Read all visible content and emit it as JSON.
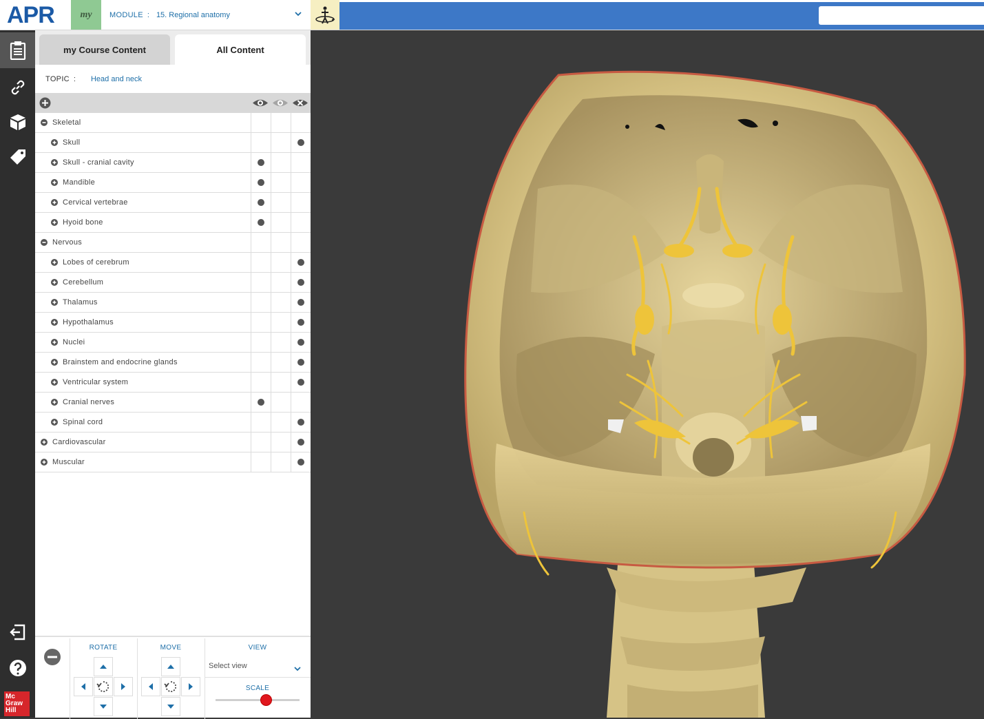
{
  "app": {
    "logo_text": "APR",
    "my_label": "my"
  },
  "module": {
    "label": "MODULE",
    "separator": ":",
    "value": "15. Regional anatomy"
  },
  "tabs": [
    {
      "label": "my Course Content",
      "active": false
    },
    {
      "label": "All Content",
      "active": true
    }
  ],
  "topic": {
    "label": "TOPIC",
    "separator": ":",
    "value": "Head and neck"
  },
  "tree": [
    {
      "label": "Skeletal",
      "level": 0,
      "expanded": true,
      "show": false,
      "ghost": false,
      "hide": false
    },
    {
      "label": "Skull",
      "level": 1,
      "expanded": false,
      "show": false,
      "ghost": false,
      "hide": true
    },
    {
      "label": "Skull - cranial cavity",
      "level": 1,
      "expanded": false,
      "show": true,
      "ghost": false,
      "hide": false
    },
    {
      "label": "Mandible",
      "level": 1,
      "expanded": false,
      "show": true,
      "ghost": false,
      "hide": false
    },
    {
      "label": "Cervical vertebrae",
      "level": 1,
      "expanded": false,
      "show": true,
      "ghost": false,
      "hide": false
    },
    {
      "label": "Hyoid bone",
      "level": 1,
      "expanded": false,
      "show": true,
      "ghost": false,
      "hide": false
    },
    {
      "label": "Nervous",
      "level": 0,
      "expanded": true,
      "show": false,
      "ghost": false,
      "hide": false
    },
    {
      "label": "Lobes of cerebrum",
      "level": 1,
      "expanded": false,
      "show": false,
      "ghost": false,
      "hide": true
    },
    {
      "label": "Cerebellum",
      "level": 1,
      "expanded": false,
      "show": false,
      "ghost": false,
      "hide": true
    },
    {
      "label": "Thalamus",
      "level": 1,
      "expanded": false,
      "show": false,
      "ghost": false,
      "hide": true
    },
    {
      "label": "Hypothalamus",
      "level": 1,
      "expanded": false,
      "show": false,
      "ghost": false,
      "hide": true
    },
    {
      "label": "Nuclei",
      "level": 1,
      "expanded": false,
      "show": false,
      "ghost": false,
      "hide": true
    },
    {
      "label": "Brainstem and endocrine glands",
      "level": 1,
      "expanded": false,
      "show": false,
      "ghost": false,
      "hide": true
    },
    {
      "label": "Ventricular system",
      "level": 1,
      "expanded": false,
      "show": false,
      "ghost": false,
      "hide": true
    },
    {
      "label": "Cranial nerves",
      "level": 1,
      "expanded": false,
      "show": true,
      "ghost": false,
      "hide": false
    },
    {
      "label": "Spinal cord",
      "level": 1,
      "expanded": false,
      "show": false,
      "ghost": false,
      "hide": true
    },
    {
      "label": "Cardiovascular",
      "level": 0,
      "expanded": false,
      "show": false,
      "ghost": false,
      "hide": true
    },
    {
      "label": "Muscular",
      "level": 0,
      "expanded": false,
      "show": false,
      "ghost": false,
      "hide": true
    }
  ],
  "controls": {
    "rotate_label": "ROTATE",
    "move_label": "MOVE",
    "view_label": "VIEW",
    "view_value": "Select view",
    "scale_label": "SCALE",
    "scale_value": 0.6
  },
  "brand": {
    "mh_line1": "Mc",
    "mh_line2": "Graw",
    "mh_line3": "Hill"
  },
  "colors": {
    "accent_blue": "#3d78c7",
    "link_blue": "#1e6fa8",
    "my_green": "#8fc993",
    "scale_knob": "#e0171e",
    "viewer_bg": "#3a3a3a"
  },
  "viewer": {
    "subject": "3D skull with cranial nerves"
  }
}
